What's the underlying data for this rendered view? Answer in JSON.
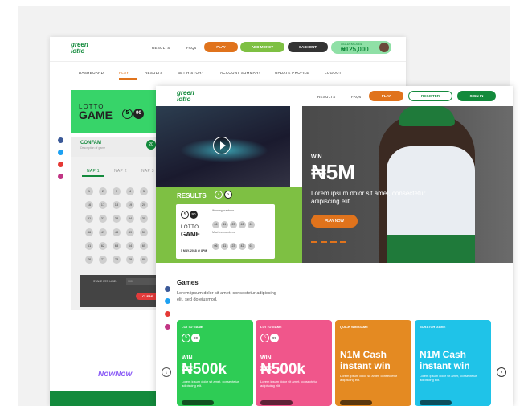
{
  "back": {
    "header_nav": [
      "RESULTS",
      "FAQs"
    ],
    "header_buttons": [
      "PLAY",
      "ADD MONEY",
      "CASHOUT"
    ],
    "wallet_label": "WALLET BALANCE",
    "wallet_value": "₦125,000",
    "subnav": [
      "DASHBOARD",
      "PLAY",
      "RESULTS",
      "BET HISTORY",
      "ACCOUNT SUMMARY",
      "UPDATE PROFILE",
      "LOGOUT"
    ],
    "lotto_game_line1": "LOTTO",
    "lotto_game_line2": "GAME",
    "lotto_nums": [
      "5",
      "90"
    ],
    "confam_title": "CONFAM",
    "confam_sub": "Description of game",
    "confam_badge": "20",
    "tabs": [
      "NAP 1",
      "NAP 2",
      "NAP 3"
    ],
    "balls": [
      "1",
      "2",
      "3",
      "4",
      "5",
      "16",
      "17",
      "18",
      "19",
      "20",
      "31",
      "32",
      "33",
      "34",
      "35",
      "46",
      "47",
      "48",
      "49",
      "50",
      "61",
      "62",
      "63",
      "64",
      "65",
      "76",
      "77",
      "78",
      "79",
      "80"
    ],
    "stake_label": "STAKE PER LINE:",
    "stake_value": "100",
    "clear_label": "CLEAR",
    "nownow": "NowNow"
  },
  "front": {
    "logo_line1": "green",
    "logo_line2": "lotto",
    "nav": [
      "RESULTS",
      "FAQs"
    ],
    "play_btn": "PLAY",
    "register_btn": "REGISTER",
    "signin_btn": "SIGN IN",
    "hero_win": "WIN",
    "hero_amount": "₦5M",
    "hero_text": "Lorem ipsum dolor sit amet, consectetur adipiscing elit.",
    "hero_btn": "PLAY NOW",
    "results_title": "RESULTS",
    "results_game": "LOTTO",
    "results_game2": "GAME",
    "results_nums": [
      "5",
      "90"
    ],
    "winning_label": "Winning numbers",
    "winning_numbers": [
      "06",
      "11",
      "23",
      "42",
      "61"
    ],
    "machine_label": "Machine numbers",
    "machine_numbers": [
      "06",
      "11",
      "23",
      "42",
      "61"
    ],
    "results_date": "5 MAY, 2018 @ 8PM",
    "games_title": "Games",
    "games_text": "Lorem ipsum dolor sit amet, consectetur adipiscing elit, sed do eiusmod.",
    "cards": [
      {
        "tag": "LOTTO GAME",
        "nums": [
          "5",
          "90"
        ],
        "win": "WIN",
        "amount": "₦500k",
        "text": "Lorem ipsum dolor sit amet, consectetur adipiscing elit.",
        "color": "#2ecc55"
      },
      {
        "tag": "LOTTO GAME",
        "nums": [
          "5",
          "99"
        ],
        "win": "WIN",
        "amount": "₦500k",
        "text": "Lorem ipsum dolor sit amet, consectetur adipiscing elit.",
        "color": "#f0568b"
      },
      {
        "tag": "QUICK WIN GAME",
        "amount": "N1M Cash instant win",
        "text": "Lorem ipsum dolor sit amet, consectetur adipiscing elit.",
        "color": "#e48a22"
      },
      {
        "tag": "SCRATCH GAME",
        "amount": "N1M Cash instant win",
        "text": "Lorem ipsum dolor sit amet, consectetur adipiscing elit.",
        "color": "#1fc3e8"
      }
    ]
  },
  "colors": {
    "green": "#138a3c",
    "orange": "#e0731c",
    "dark": "#333333",
    "lime": "#7ec043"
  }
}
